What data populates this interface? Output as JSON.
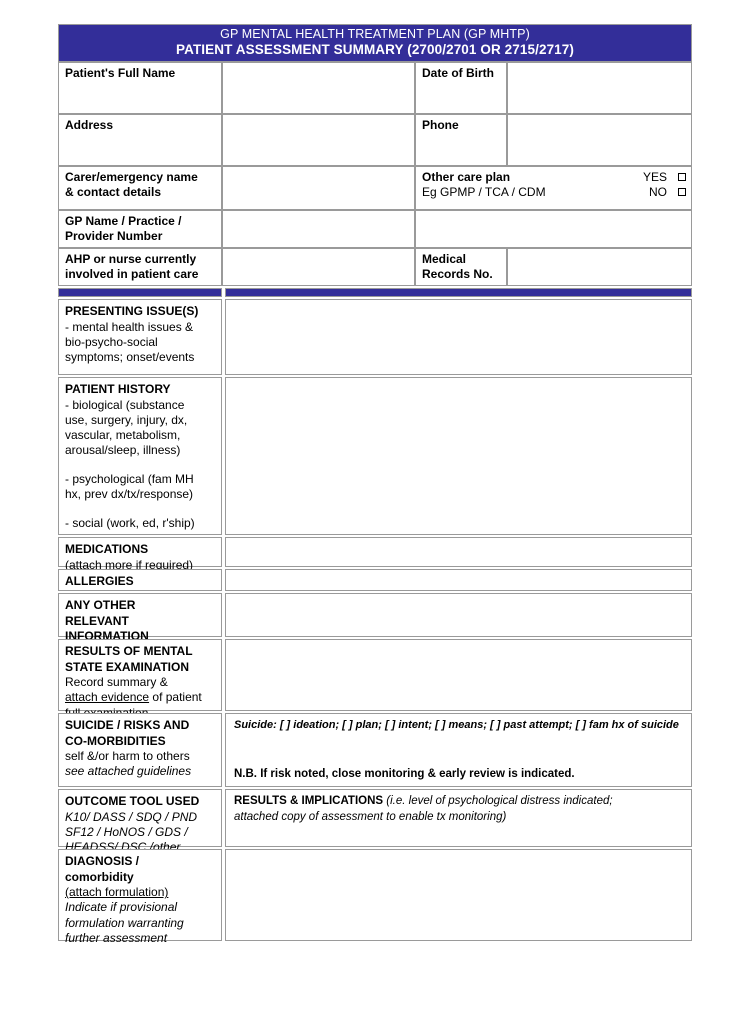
{
  "header": {
    "line1": "GP MENTAL HEALTH TREATMENT PLAN (GP MHTP)",
    "line2": "PATIENT ASSESSMENT SUMMARY (2700/2701 OR 2715/2717)",
    "banner_color": "#332E99"
  },
  "identity": {
    "patient_name_label": "Patient's Full Name",
    "patient_name_value": "",
    "dob_label": "Date of Birth",
    "dob_value": "",
    "address_label": "Address",
    "address_value": "",
    "phone_label": "Phone",
    "phone_value": "",
    "carer_label_line1": "Carer/emergency name",
    "carer_label_line2": "& contact details",
    "carer_value": "",
    "other_care_plan_line1": "Other care plan",
    "other_care_plan_line2": "Eg GPMP / TCA / CDM",
    "yes_label": "YES",
    "no_label": "NO",
    "gp_label_line1": "GP Name / Practice /",
    "gp_label_line2": "Provider Number",
    "gp_value": "",
    "ahp_label_line1": "AHP or nurse currently",
    "ahp_label_line2": "involved in patient care",
    "ahp_value": "",
    "mrn_label_line1": "Medical",
    "mrn_label_line2": "Records No.",
    "mrn_value": ""
  },
  "sections": {
    "presenting": {
      "title": "PRESENTING ISSUE(S)",
      "desc_lines": [
        "- mental health issues &",
        "bio-psycho-social",
        "symptoms; onset/events"
      ],
      "value": ""
    },
    "history": {
      "title": "PATIENT HISTORY",
      "biological_lines": [
        "- biological (substance",
        "use, surgery, injury, dx,",
        "vascular, metabolism,",
        "arousal/sleep, illness)"
      ],
      "psychological_lines": [
        "- psychological (fam MH",
        "hx, prev dx/tx/response)"
      ],
      "social_lines": [
        "- social (work, ed, r'ship)"
      ],
      "value": ""
    },
    "medications": {
      "title": "MEDICATIONS",
      "subtitle": "(attach more if required)",
      "value": ""
    },
    "allergies": {
      "title": "ALLERGIES",
      "value": ""
    },
    "other_info": {
      "title_lines": [
        "ANY OTHER",
        "RELEVANT",
        "INFORMATION"
      ],
      "value": ""
    },
    "mse": {
      "title_lines": [
        "RESULTS OF MENTAL",
        "STATE EXAMINATION"
      ],
      "desc_line1": "Record summary &",
      "desc_underlined": "attach evidence",
      "desc_line2_rest": " of patient",
      "desc_line3": "full examination",
      "value": ""
    },
    "suicide": {
      "title_lines": [
        "SUICIDE / RISKS AND",
        "CO-MORBIDITIES"
      ],
      "desc_plain": "self &/or harm to others",
      "desc_italic": "see attached guidelines",
      "checklist": "Suicide: [  ] ideation; [  ] plan; [  ] intent; [  ] means; [  ] past attempt; [  ] fam hx of suicide",
      "note": "N.B. If risk noted, close monitoring & early review is indicated."
    },
    "outcome_tool": {
      "title": "OUTCOME TOOL USED",
      "tool_lines": [
        "K10/ DASS / SDQ / PND",
        "SF12 / HoNOS / GDS /",
        "HEADSS/ DSC  /other"
      ],
      "results_heading": "RESULTS & IMPLICATIONS",
      "results_note_line1": "(i.e. level of psychological distress indicated;",
      "results_note_line2": "attached copy of assessment to enable tx monitoring)",
      "value": ""
    },
    "diagnosis": {
      "title_line1": "DIAGNOSIS /",
      "title_line2": "comorbidity",
      "attach_underlined": "(attach formulation)",
      "italic_lines": [
        "Indicate if provisional",
        "formulation warranting",
        "further assessment"
      ],
      "value": ""
    }
  }
}
